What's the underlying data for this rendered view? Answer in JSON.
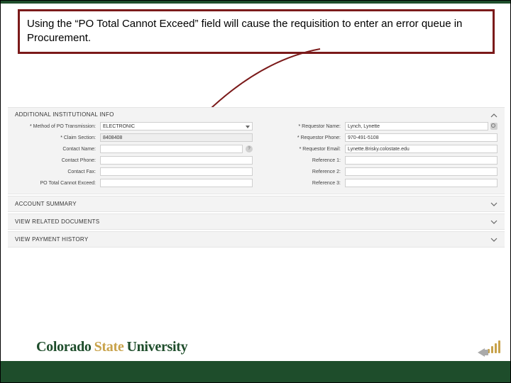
{
  "callout_text": "Using the “PO Total Cannot Exceed” field will cause the requisition to enter an error queue in Procurement.",
  "form": {
    "section_open": {
      "title": "ADDITIONAL INSTITUTIONAL INFO"
    },
    "left": {
      "method_label": "Method of PO Transmission:",
      "method_value": "ELECTRONIC",
      "claim_label": "Claim Section:",
      "claim_value": "8408408",
      "contact_name_label": "Contact Name:",
      "contact_name_value": "",
      "contact_phone_label": "Contact Phone:",
      "contact_phone_value": "",
      "contact_fax_label": "Contact Fax:",
      "contact_fax_value": "",
      "po_total_label": "PO Total Cannot Exceed:",
      "po_total_value": ""
    },
    "right": {
      "req_name_label": "Requestor Name:",
      "req_name_value": "Lynch, Lynette",
      "req_phone_label": "Requestor Phone:",
      "req_phone_value": "970-491-5108",
      "req_email_label": "Requestor Email:",
      "req_email_value": "Lynette.Brisky.colostate.edu",
      "ref1_label": "Reference 1:",
      "ref1_value": "",
      "ref2_label": "Reference 2:",
      "ref2_value": "",
      "ref3_label": "Reference 3:",
      "ref3_value": ""
    },
    "sections_collapsed": [
      "ACCOUNT SUMMARY",
      "VIEW RELATED DOCUMENTS",
      "VIEW PAYMENT HISTORY"
    ]
  },
  "logo": {
    "left": "Colorado",
    "mid": "State",
    "right": "University"
  }
}
